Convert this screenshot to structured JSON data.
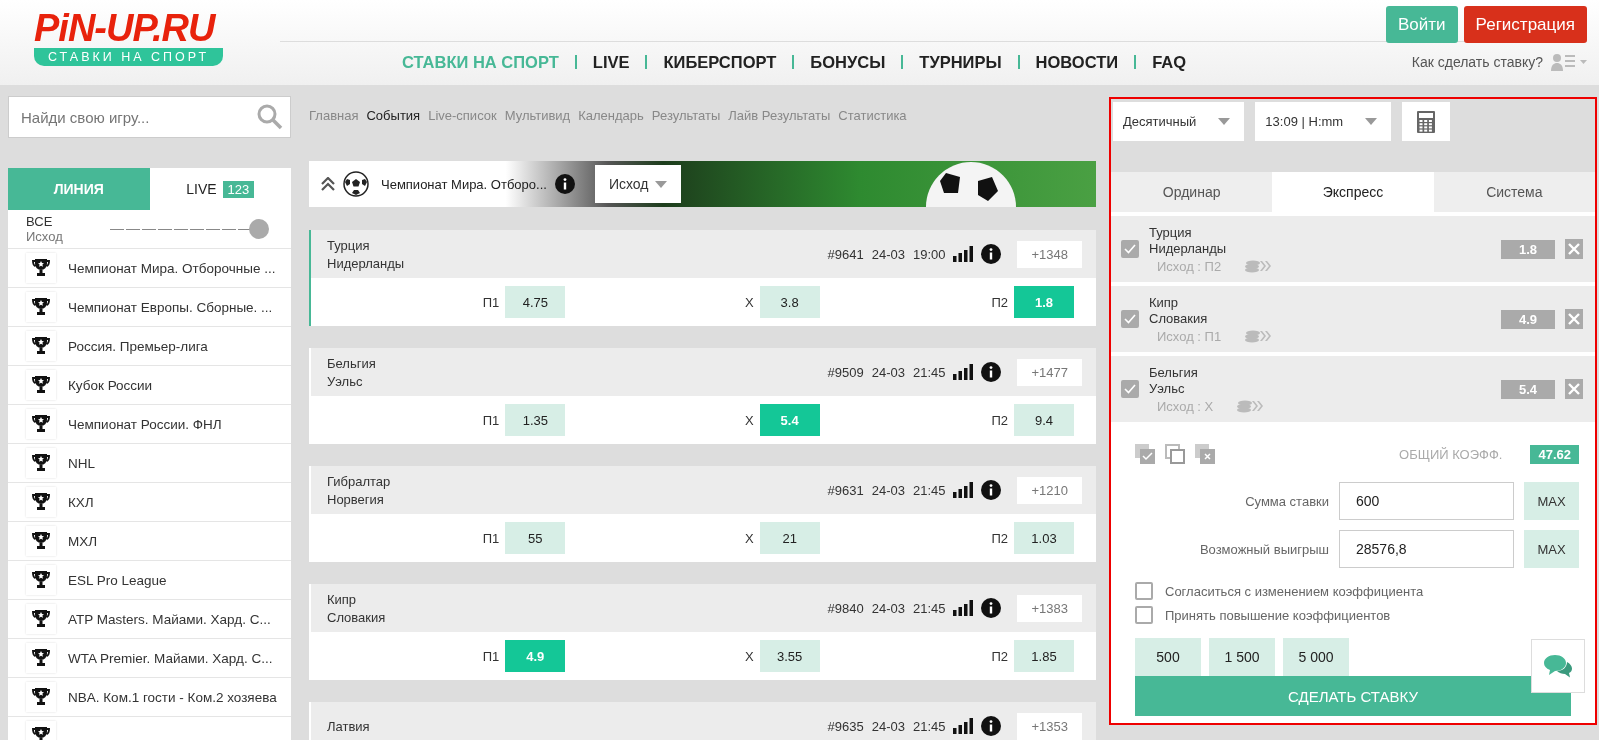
{
  "logo": {
    "title": "PiN-UP.RU",
    "tagline": "СТАВКИ НА СПОРТ"
  },
  "auth_buttons": [
    {
      "label": "Войти",
      "kind": "login"
    },
    {
      "label": "Регистрация",
      "kind": "register"
    }
  ],
  "nav": [
    {
      "label": "СТАВКИ НА СПОРТ",
      "selected": true
    },
    {
      "label": "LIVE",
      "selected": false
    },
    {
      "label": "КИБЕРСПОРТ",
      "selected": false
    },
    {
      "label": "БОНУСЫ",
      "selected": false
    },
    {
      "label": "ТУРНИРЫ",
      "selected": false
    },
    {
      "label": "НОВОСТИ",
      "selected": false
    },
    {
      "label": "FAQ",
      "selected": false
    }
  ],
  "help_link": "Как сделать ставку?",
  "search": {
    "placeholder": "Найди свою игру..."
  },
  "breadcrumbs": [
    {
      "label": "Главная",
      "selected": false
    },
    {
      "label": "События",
      "selected": true
    },
    {
      "label": "Live-список",
      "selected": false
    },
    {
      "label": "Мультивид",
      "selected": false
    },
    {
      "label": "Календарь",
      "selected": false
    },
    {
      "label": "Результаты",
      "selected": false
    },
    {
      "label": "Лайв Результаты",
      "selected": false
    },
    {
      "label": "Статистика",
      "selected": false
    }
  ],
  "sidebar": {
    "tabs": [
      {
        "label": "ЛИНИЯ",
        "selected": true
      },
      {
        "label": "LIVE",
        "badge": "123",
        "selected": false
      }
    ],
    "filter": {
      "title": "ВСЕ",
      "subtitle": "Исход",
      "level": 1
    },
    "items": [
      "Чемпионат Мира. Отборочные ...",
      "Чемпионат Европы. Сборные. ...",
      "Россия. Премьер-лига",
      "Кубок России",
      "Чемпионат России. ФНЛ",
      "NHL",
      "КХЛ",
      "МХЛ",
      "ESL Pro League",
      "ATP Masters. Майами. Хард. С...",
      "WTA Premier. Майами. Хард. С...",
      "NBA. Ком.1 гости - Ком.2 хозяева"
    ]
  },
  "league": {
    "title": "Чемпионат Мира. Отборо...",
    "market": "Исход"
  },
  "matches": [
    {
      "teams": [
        "Турция",
        "Нидерланды"
      ],
      "id": "#9641",
      "date": "24-03",
      "time": "19:00",
      "more": "+1348",
      "selected": true,
      "odds": [
        {
          "label": "П1",
          "value": "4.75",
          "selected": false
        },
        {
          "label": "X",
          "value": "3.8",
          "selected": false
        },
        {
          "label": "П2",
          "value": "1.8",
          "selected": true
        }
      ]
    },
    {
      "teams": [
        "Бельгия",
        "Уэльс"
      ],
      "id": "#9509",
      "date": "24-03",
      "time": "21:45",
      "more": "+1477",
      "selected": false,
      "odds": [
        {
          "label": "П1",
          "value": "1.35",
          "selected": false
        },
        {
          "label": "X",
          "value": "5.4",
          "selected": true
        },
        {
          "label": "П2",
          "value": "9.4",
          "selected": false
        }
      ]
    },
    {
      "teams": [
        "Гибралтар",
        "Норвегия"
      ],
      "id": "#9631",
      "date": "24-03",
      "time": "21:45",
      "more": "+1210",
      "selected": false,
      "odds": [
        {
          "label": "П1",
          "value": "55",
          "selected": false
        },
        {
          "label": "X",
          "value": "21",
          "selected": false
        },
        {
          "label": "П2",
          "value": "1.03",
          "selected": false
        }
      ]
    },
    {
      "teams": [
        "Кипр",
        "Словакия"
      ],
      "id": "#9840",
      "date": "24-03",
      "time": "21:45",
      "more": "+1383",
      "selected": false,
      "odds": [
        {
          "label": "П1",
          "value": "4.9",
          "selected": true
        },
        {
          "label": "X",
          "value": "3.55",
          "selected": false
        },
        {
          "label": "П2",
          "value": "1.85",
          "selected": false
        }
      ]
    },
    {
      "teams": [
        "Латвия"
      ],
      "id": "#9635",
      "date": "24-03",
      "time": "21:45",
      "more": "+1353",
      "selected": false
    }
  ],
  "bet_slip": {
    "odds_format": "Десятичный",
    "time_format": "13:09 | H:mm",
    "tabs": [
      {
        "label": "Ординар",
        "selected": false
      },
      {
        "label": "Экспресс",
        "selected": true
      },
      {
        "label": "Система",
        "selected": false
      }
    ],
    "bets": [
      {
        "teams": [
          "Турция",
          "Нидерланды"
        ],
        "outcome": "Исход : П2",
        "odds": "1.8",
        "checked": true
      },
      {
        "teams": [
          "Кипр",
          "Словакия"
        ],
        "outcome": "Исход : П1",
        "odds": "4.9",
        "checked": true
      },
      {
        "teams": [
          "Бельгия",
          "Уэльс"
        ],
        "outcome": "Исход : X",
        "odds": "5.4",
        "checked": true
      }
    ],
    "total_label": "ОБЩИЙ КОЭФФ.",
    "total": "47.62",
    "fields": [
      {
        "label": "Сумма ставки",
        "value": "600",
        "max": "MAX"
      },
      {
        "label": "Возможный выигрыш",
        "value": "28576,8",
        "max": "MAX"
      }
    ],
    "options": [
      {
        "label": "Согласиться с изменением коэффициента",
        "checked": false
      },
      {
        "label": "Принять повышение коэффициентов",
        "checked": false
      }
    ],
    "quick_amounts": [
      "500",
      "1 500",
      "5 000"
    ],
    "submit": "СДЕЛАТЬ СТАВКУ"
  }
}
